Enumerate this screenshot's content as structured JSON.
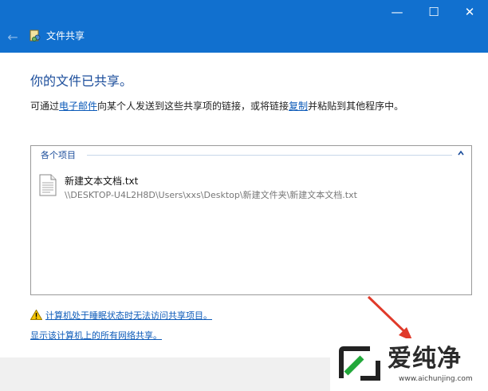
{
  "window": {
    "title": "文件共享",
    "minimize_glyph": "—",
    "maximize_glyph": "☐",
    "close_glyph": "✕",
    "back_glyph": "←",
    "accent_color": "#1170cf"
  },
  "main": {
    "heading": "你的文件已共享。",
    "instruction": {
      "part1": "可通过",
      "email_link": "电子邮件",
      "part2": "向某个人发送到这些共享项的链接，或将链接",
      "copy_link": "复制",
      "part3": "并粘贴到其他程序中。"
    }
  },
  "items_group": {
    "title": "各个项目",
    "files": [
      {
        "name": "新建文本文档.txt",
        "path": "\\\\DESKTOP-U4L2H8D\\Users\\xxs\\Desktop\\新建文件夹\\新建文本文档.txt",
        "icon": "text-document-icon"
      }
    ]
  },
  "footer_links": {
    "sleep_warning": "计算机处于睡眠状态时无法访问共享项目。",
    "show_shares": "显示该计算机上的所有网络共享。"
  },
  "watermark": {
    "brand": "爱纯净",
    "url": "www.aichunjing.com"
  }
}
